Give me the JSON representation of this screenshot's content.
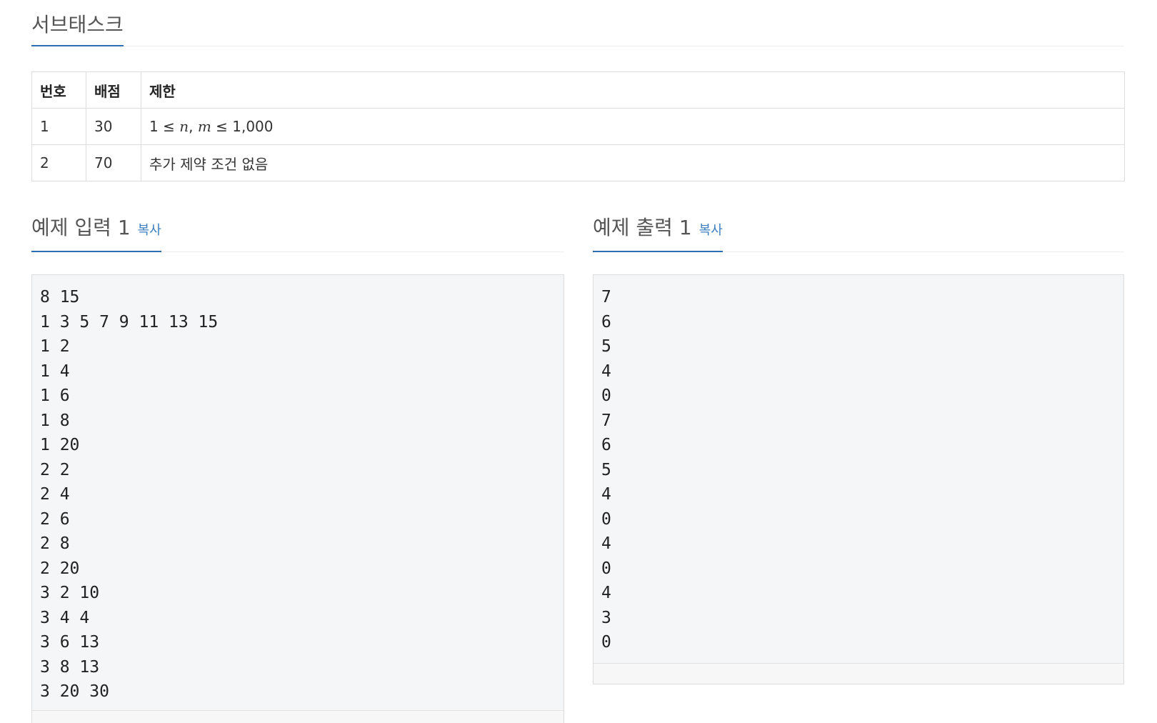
{
  "subtask": {
    "title": "서브태스크",
    "headers": [
      "번호",
      "배점",
      "제한"
    ],
    "rows": [
      {
        "no": "1",
        "score": "30",
        "limit": {
          "pre": "1 ≤ ",
          "v1": "n",
          "mid": ", ",
          "v2": "m",
          "post": " ≤ 1,000"
        }
      },
      {
        "no": "2",
        "score": "70",
        "limit_text": "추가 제약 조건 없음"
      }
    ]
  },
  "sample_input": {
    "title": "예제 입력 1",
    "copy_label": "복사",
    "text": "8 15\n1 3 5 7 9 11 13 15\n1 2\n1 4\n1 6\n1 8\n1 20\n2 2\n2 4\n2 6\n2 8\n2 20\n3 2 10\n3 4 4\n3 6 13\n3 8 13\n3 20 30"
  },
  "sample_output": {
    "title": "예제 출력 1",
    "copy_label": "복사",
    "text": "7\n6\n5\n4\n0\n7\n6\n5\n4\n0\n4\n0\n4\n3\n0"
  },
  "colors": {
    "accent": "#2a6fb3",
    "link": "#3d7fc0",
    "code_bg": "#f5f6f7"
  }
}
